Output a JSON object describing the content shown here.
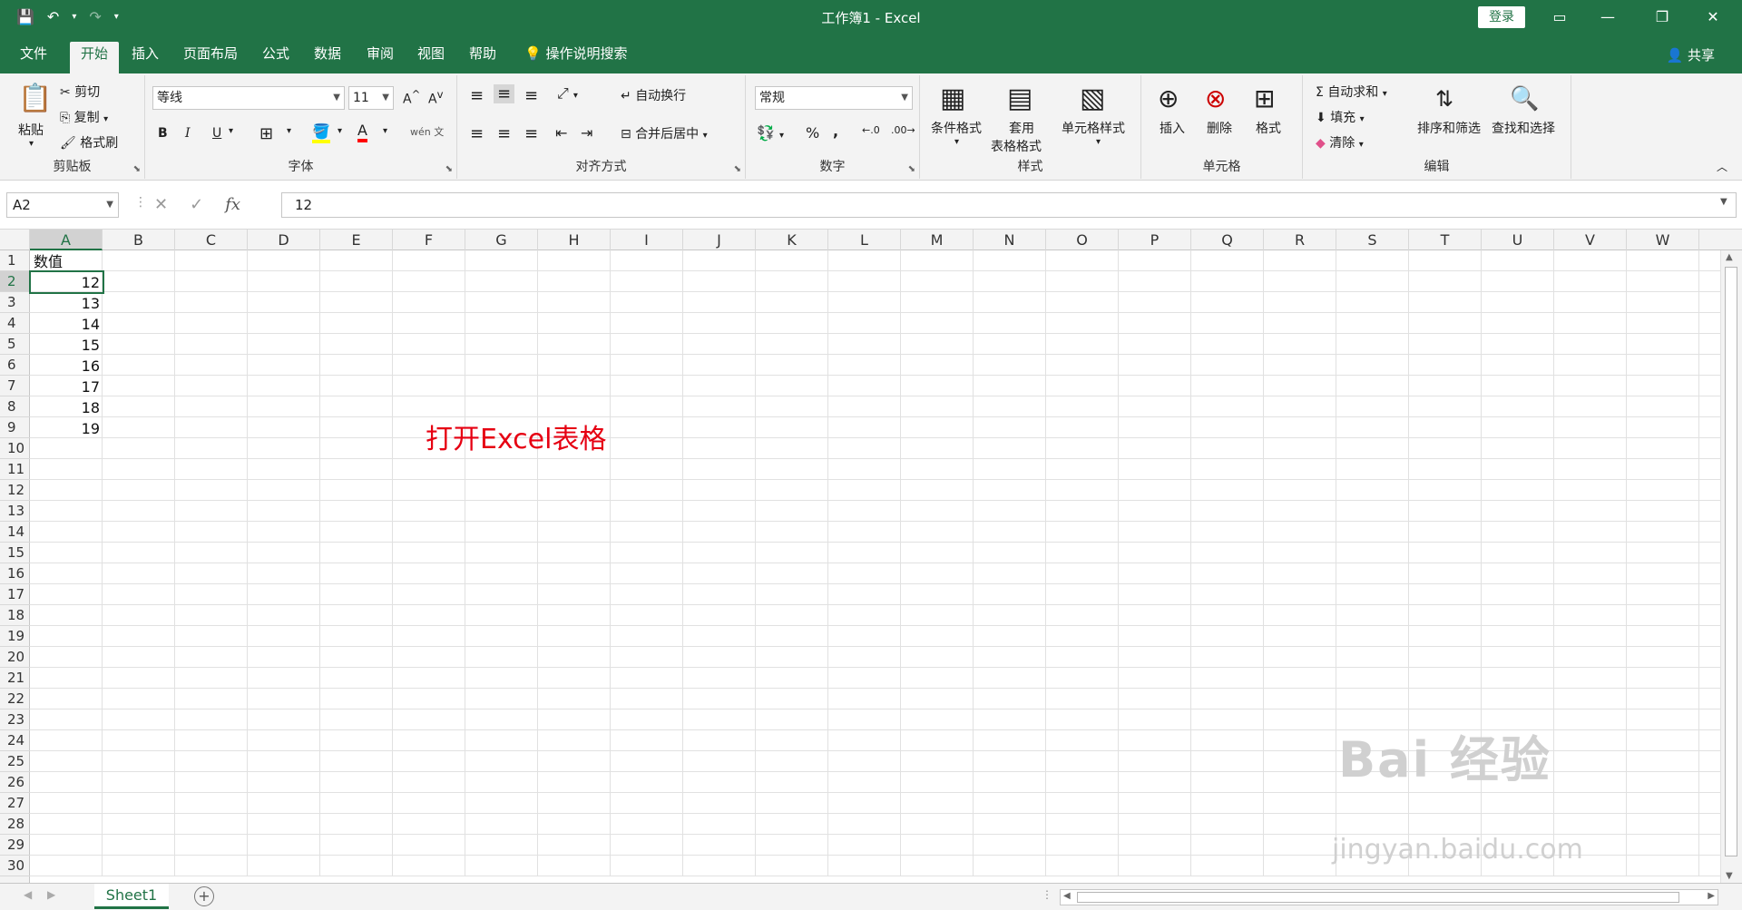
{
  "window": {
    "title": "工作簿1  -  Excel",
    "login_label": "登录"
  },
  "ribbon_tabs": {
    "file": "文件",
    "home": "开始",
    "insert": "插入",
    "page_layout": "页面布局",
    "formulas": "公式",
    "data": "数据",
    "review": "审阅",
    "view": "视图",
    "help": "帮助",
    "tell_me": "操作说明搜索",
    "share": "共享"
  },
  "clipboard": {
    "group": "剪贴板",
    "paste": "粘贴",
    "cut": "剪切",
    "copy": "复制",
    "format_painter": "格式刷"
  },
  "font": {
    "group": "字体",
    "name": "等线",
    "size": "11",
    "bold": "B",
    "italic": "I",
    "underline": "U",
    "phonetic": "wén 文"
  },
  "alignment": {
    "group": "对齐方式",
    "wrap_text": "自动换行",
    "merge_center": "合并后居中"
  },
  "number": {
    "group": "数字",
    "format": "常规",
    "percent": "%",
    "comma": ","
  },
  "styles": {
    "group": "样式",
    "conditional": "条件格式",
    "table_line1": "套用",
    "table_line2": "表格格式",
    "cell_styles": "单元格样式"
  },
  "cells": {
    "group": "单元格",
    "insert": "插入",
    "delete": "删除",
    "format": "格式"
  },
  "editing": {
    "group": "编辑",
    "autosum": "自动求和",
    "fill": "填充",
    "clear": "清除",
    "sort_filter": "排序和筛选",
    "find_select": "查找和选择"
  },
  "formula_bar": {
    "name_box": "A2",
    "fx": "fx",
    "content": "12"
  },
  "columns": [
    "A",
    "B",
    "C",
    "D",
    "E",
    "F",
    "G",
    "H",
    "I",
    "J",
    "K",
    "L",
    "M",
    "N",
    "O",
    "P",
    "Q",
    "R",
    "S",
    "T",
    "U",
    "V",
    "W"
  ],
  "rows": [
    "1",
    "2",
    "3",
    "4",
    "5",
    "6",
    "7",
    "8",
    "9",
    "10",
    "11",
    "12",
    "13",
    "14",
    "15",
    "16",
    "17",
    "18",
    "19",
    "20",
    "21",
    "22",
    "23",
    "24",
    "25",
    "26",
    "27",
    "28",
    "29",
    "30"
  ],
  "sheet_cells": {
    "A1": "数值",
    "A2": "12",
    "A3": "13",
    "A4": "14",
    "A5": "15",
    "A6": "16",
    "A7": "17",
    "A8": "18",
    "A9": "19"
  },
  "annotation": "打开Excel表格",
  "watermark": {
    "line1": "Bai 经验",
    "line2": "jingyan.baidu.com"
  },
  "sheets": {
    "active": "Sheet1",
    "add": "+"
  }
}
